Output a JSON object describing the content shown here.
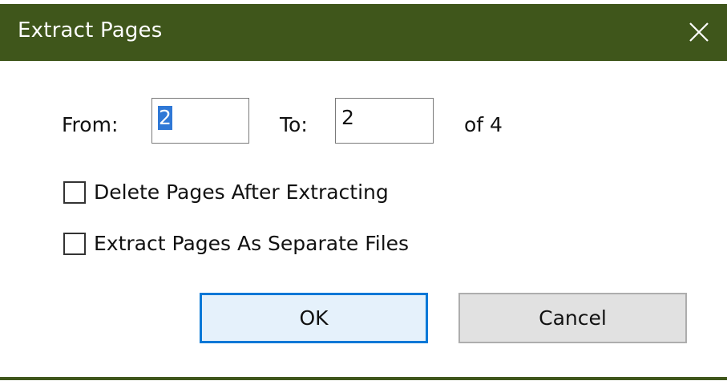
{
  "window": {
    "title": "Extract Pages",
    "titlebar_color": "#3f561b"
  },
  "range": {
    "from_label": "From:",
    "from_value": "2",
    "to_label": "To:",
    "to_value": "2",
    "of_text": "of 4"
  },
  "options": {
    "delete_after": {
      "label": "Delete Pages After Extracting",
      "checked": false
    },
    "separate_files": {
      "label": "Extract Pages As Separate Files",
      "checked": false
    }
  },
  "buttons": {
    "ok": "OK",
    "cancel": "Cancel"
  },
  "icons": {
    "close": "close-icon"
  },
  "colors": {
    "accent": "#0078d7",
    "selection": "#2f78d6"
  }
}
